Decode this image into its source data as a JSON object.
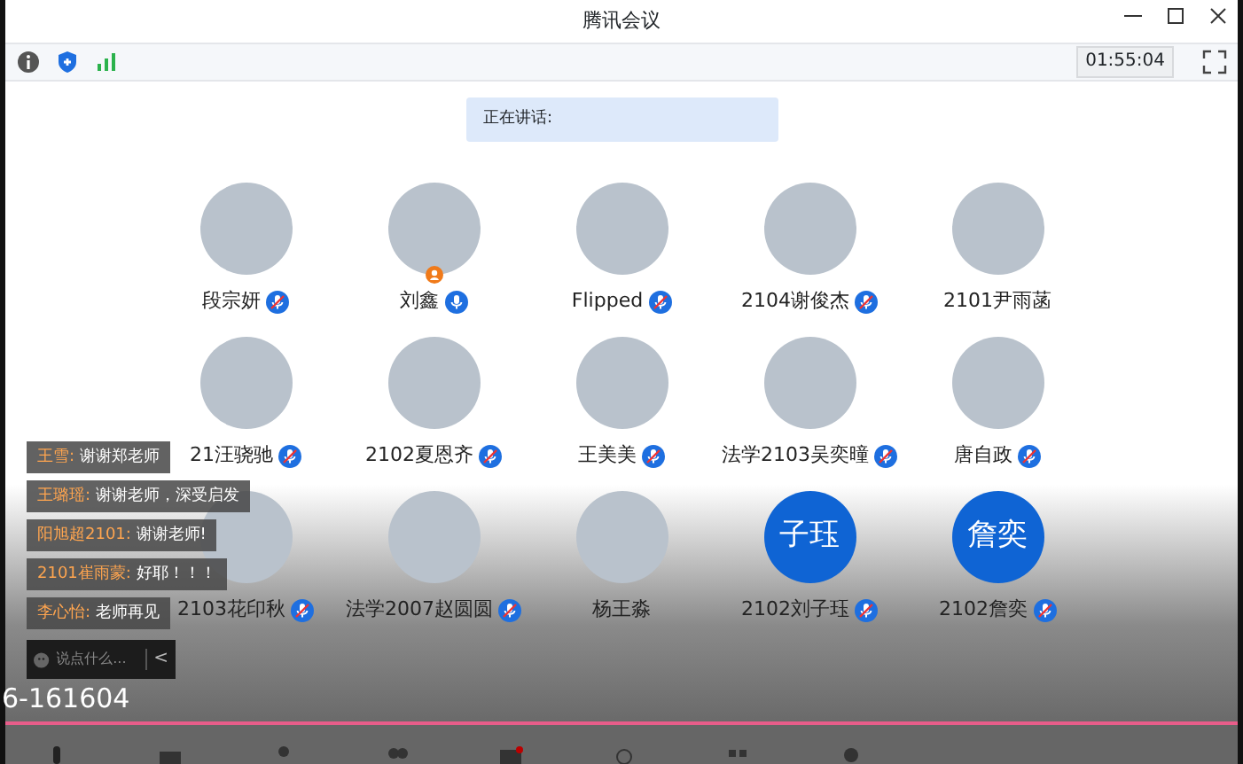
{
  "window": {
    "title": "腾讯会议"
  },
  "toolbar": {
    "timer": "01:55:04"
  },
  "speaking": {
    "label": "正在讲话:"
  },
  "participants": [
    {
      "name": "段宗妍",
      "kind": "photo",
      "muted": true
    },
    {
      "name": "刘鑫",
      "kind": "photo",
      "muted": false,
      "host": true
    },
    {
      "name": "Flipped",
      "kind": "photo",
      "muted": true
    },
    {
      "name": "2104谢俊杰",
      "kind": "photo",
      "muted": true
    },
    {
      "name": "2101尹雨菡",
      "kind": "photo"
    },
    {
      "name": "21汪骁驰",
      "kind": "photo",
      "muted": true
    },
    {
      "name": "2102夏恩齐",
      "kind": "photo",
      "muted": true
    },
    {
      "name": "王美美",
      "kind": "photo",
      "muted": true
    },
    {
      "name": "法学2103吴奕曈",
      "kind": "photo",
      "muted": true
    },
    {
      "name": "唐自政",
      "kind": "photo",
      "muted": true
    },
    {
      "name": "2103花印秋",
      "kind": "photo",
      "muted": true
    },
    {
      "name": "法学2007赵圆圆",
      "kind": "photo",
      "muted": true
    },
    {
      "name": "杨王淼",
      "kind": "photo"
    },
    {
      "name": "2102刘子珏",
      "kind": "text",
      "avatar_text": "子珏",
      "muted": true
    },
    {
      "name": "2102詹奕",
      "kind": "text",
      "avatar_text": "詹奕",
      "muted": true
    }
  ],
  "chat": {
    "messages": [
      {
        "sender": "王雪:",
        "text": "谢谢郑老师"
      },
      {
        "sender": "王璐瑶:",
        "text": "谢谢老师，深受启发"
      },
      {
        "sender": "阳旭超2101:",
        "text": "谢谢老师!"
      },
      {
        "sender": "2101崔雨蒙:",
        "text": "好耶！！！"
      },
      {
        "sender": "李心怡:",
        "text": "老师再见"
      }
    ],
    "placeholder": "说点什么...",
    "collapse": "<"
  },
  "meeting_code": "6-161604"
}
